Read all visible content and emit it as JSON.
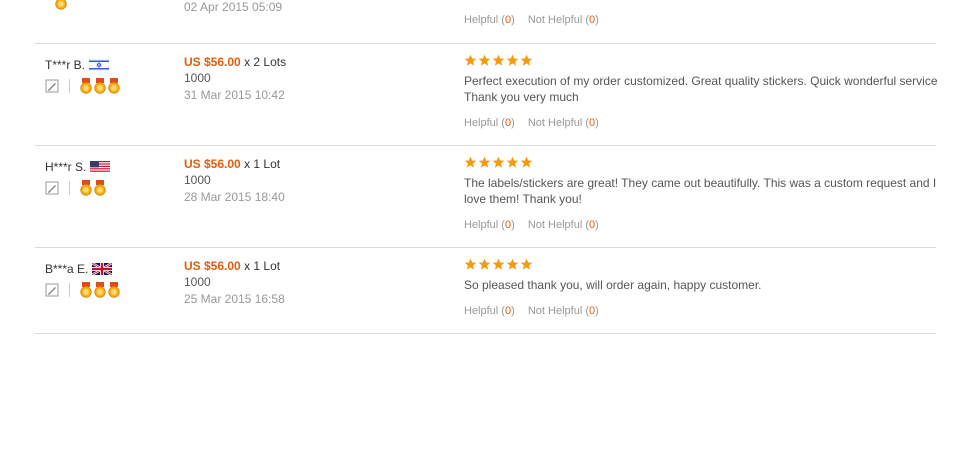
{
  "top_partial": {
    "date": "02 Apr 2015 05:09",
    "helpful_label": "Helpful",
    "helpful_count": "0",
    "not_helpful_label": "Not Helpful",
    "not_helpful_count": "0"
  },
  "reviews": [
    {
      "username": "T***r B.",
      "flag": "israel-flag-icon",
      "medals": 3,
      "price": "US $56.00",
      "quantity": "x 2 Lots",
      "variant": "1000",
      "date": "31 Mar 2015 10:42",
      "stars": 5,
      "comment": "Perfect execution of my order customized. Great quality stickers. Quick wonderful service Thank you very much",
      "helpful_label": "Helpful",
      "helpful_count": "0",
      "not_helpful_label": "Not Helpful",
      "not_helpful_count": "0"
    },
    {
      "username": "H***r S.",
      "flag": "usa-flag-icon",
      "medals": 2,
      "price": "US $56.00",
      "quantity": "x 1 Lot",
      "variant": "1000",
      "date": "28 Mar 2015 18:40",
      "stars": 5,
      "comment": "The labels/stickers are great! They came out beautifully. This was a custom request and I love them! Thank you!",
      "helpful_label": "Helpful",
      "helpful_count": "0",
      "not_helpful_label": "Not Helpful",
      "not_helpful_count": "0"
    },
    {
      "username": "B***a E.",
      "flag": "uk-flag-icon",
      "medals": 3,
      "price": "US $56.00",
      "quantity": "x 1 Lot",
      "variant": "1000",
      "date": "25 Mar 2015 16:58",
      "stars": 5,
      "comment": "So pleased thank you, will order again, happy customer.",
      "helpful_label": "Helpful",
      "helpful_count": "0",
      "not_helpful_label": "Not Helpful",
      "not_helpful_count": "0"
    }
  ],
  "colors": {
    "price": "#e15c0c",
    "star": "#f39c12",
    "divider": "#dcdcdc",
    "medal": "#f0a81c"
  }
}
